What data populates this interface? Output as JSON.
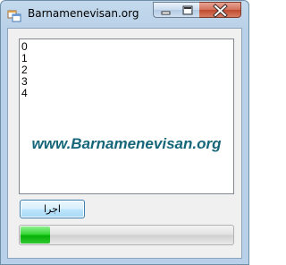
{
  "window": {
    "title": "Barnamenevisan.org"
  },
  "listbox": {
    "items": [
      "0",
      "1",
      "2",
      "3",
      "4"
    ],
    "watermark": "www.Barnamenevisan.org"
  },
  "buttons": {
    "run_label": "اجرا"
  },
  "progress": {
    "percent": 14
  },
  "icons": {
    "app": "form-icon",
    "minimize": "minimize-icon",
    "maximize": "maximize-icon",
    "close": "close-icon"
  },
  "colors": {
    "progress_fill": "#06b006",
    "watermark": "#16667a",
    "close_button": "#c04a30"
  }
}
